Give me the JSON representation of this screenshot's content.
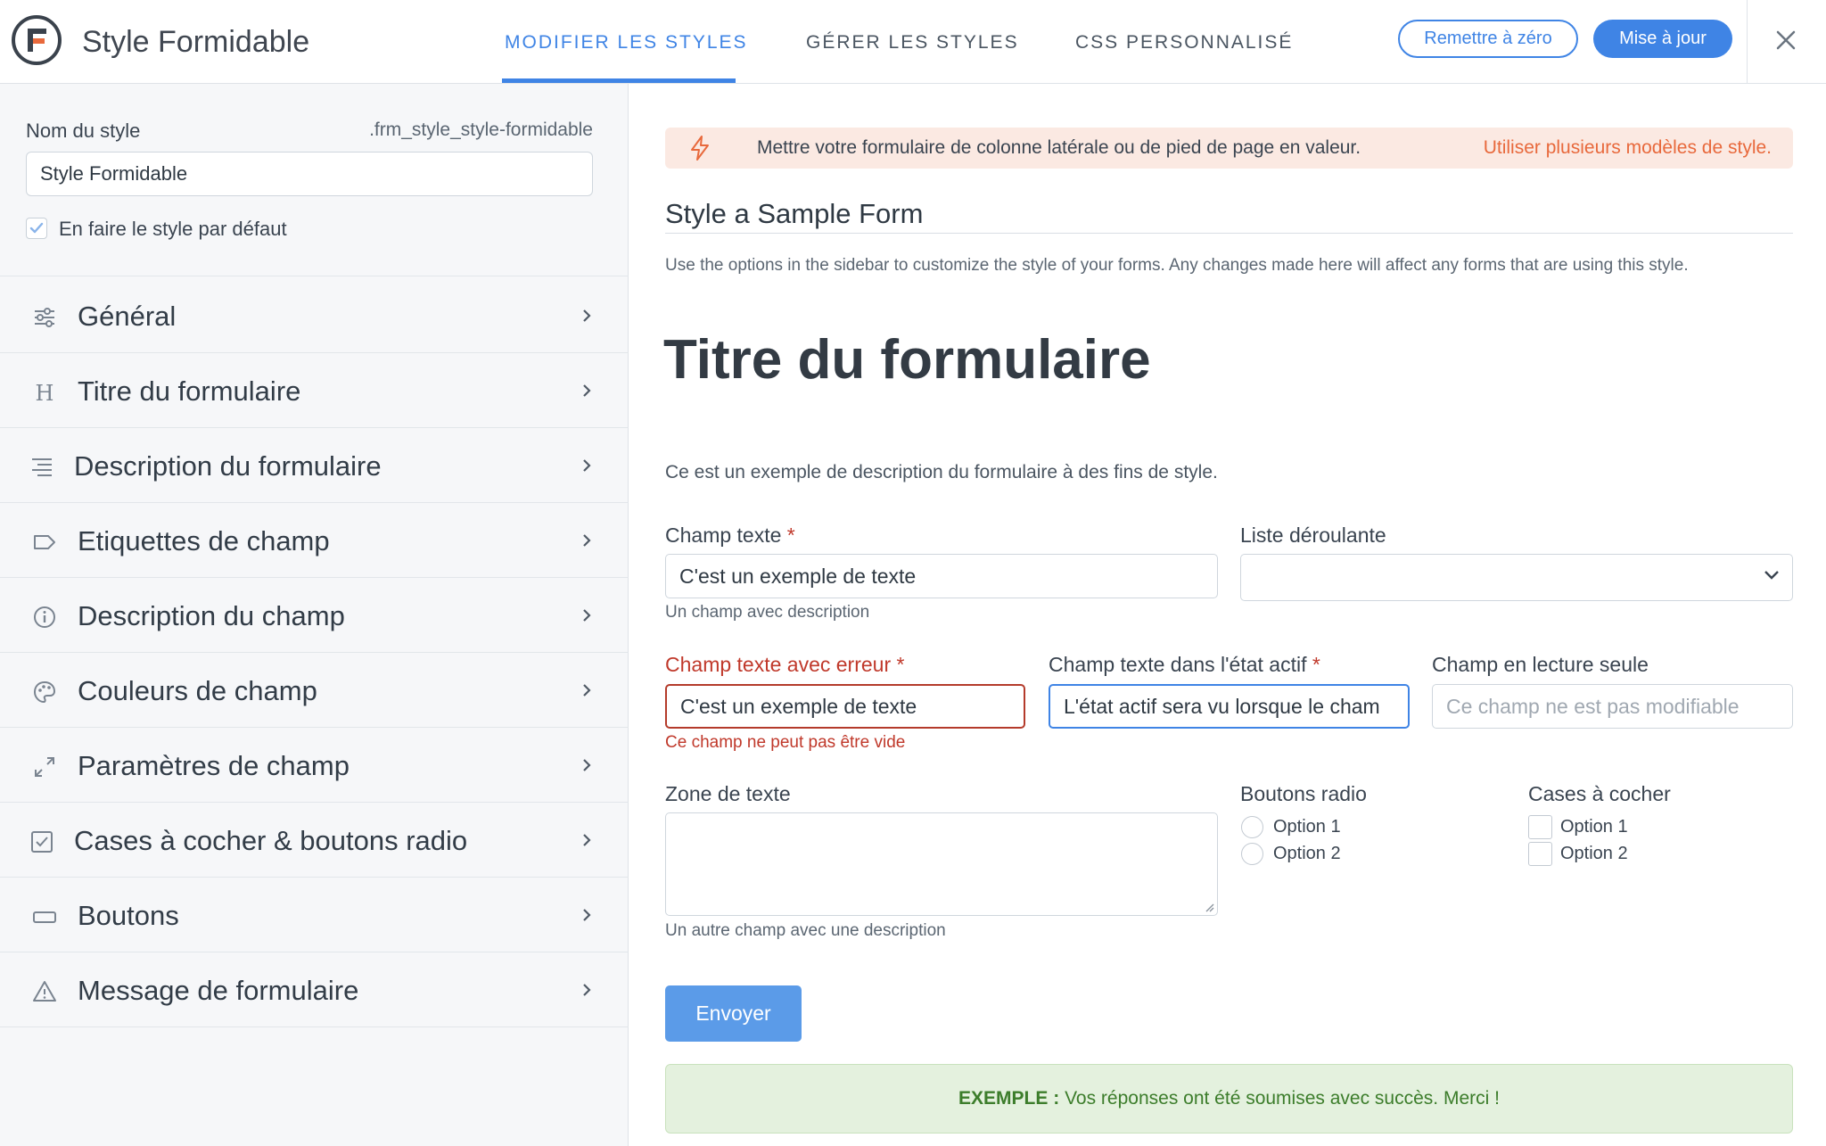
{
  "header": {
    "app_title": "Style Formidable",
    "tabs": [
      {
        "label": "MODIFIER LES STYLES"
      },
      {
        "label": "GÉRER LES STYLES"
      },
      {
        "label": "CSS PERSONNALISÉ"
      }
    ],
    "reset_label": "Remettre à zéro",
    "update_label": "Mise à jour"
  },
  "sidebar": {
    "style_name_label": "Nom du style",
    "style_class": ".frm_style_style-formidable",
    "style_name_value": "Style Formidable",
    "default_checkbox_label": "En faire le style par défaut",
    "default_checked": true,
    "sections": [
      {
        "label": "Général",
        "icon": "sliders-icon"
      },
      {
        "label": "Titre du formulaire",
        "icon": "heading-icon"
      },
      {
        "label": "Description du formulaire",
        "icon": "align-text-icon"
      },
      {
        "label": "Etiquettes de champ",
        "icon": "tag-icon"
      },
      {
        "label": "Description du champ",
        "icon": "info-icon"
      },
      {
        "label": "Couleurs de champ",
        "icon": "palette-icon"
      },
      {
        "label": "Paramètres de champ",
        "icon": "expand-arrows-icon"
      },
      {
        "label": "Cases à cocher & boutons radio",
        "icon": "checkbox-icon"
      },
      {
        "label": "Boutons",
        "icon": "button-icon"
      },
      {
        "label": "Message de formulaire",
        "icon": "warning-icon"
      }
    ]
  },
  "notice": {
    "text": "Mettre votre formulaire de colonne latérale ou de pied de page en valeur.",
    "link": "Utiliser plusieurs modèles de style."
  },
  "preview": {
    "section_title": "Style a Sample Form",
    "section_desc": "Use the options in the sidebar to customize the style of your forms. Any changes made here will affect any forms that are using this style.",
    "form_title": "Titre du formulaire",
    "form_description": "Ce est un exemple de description du formulaire à des fins de style.",
    "fields": {
      "text": {
        "label": "Champ texte",
        "value": "C'est un exemple de texte",
        "help": "Un champ avec description"
      },
      "dropdown": {
        "label": "Liste déroulante",
        "value": ""
      },
      "error": {
        "label": "Champ texte avec erreur",
        "value": "C'est un exemple de texte",
        "help": "Ce champ ne peut pas être vide"
      },
      "active": {
        "label": "Champ texte dans l'état actif",
        "value": "L'état actif sera vu lorsque le cham"
      },
      "readonly": {
        "label": "Champ en lecture seule",
        "placeholder": "Ce champ ne est pas modifiable"
      },
      "textarea": {
        "label": "Zone de texte",
        "help": "Un autre champ avec une description"
      },
      "radios": {
        "label": "Boutons radio",
        "options": [
          "Option 1",
          "Option 2"
        ]
      },
      "checkboxes": {
        "label": "Cases à cocher",
        "options": [
          "Option 1",
          "Option 2"
        ]
      }
    },
    "required_mark": "*",
    "submit_label": "Envoyer",
    "success": {
      "prefix": "EXEMPLE :",
      "message": "Vos réponses ont été soumises avec succès. Merci !"
    }
  },
  "colors": {
    "accent": "#3f84e5",
    "error": "#c0392b",
    "notice_bg": "#fbe9e2",
    "notice_link": "#e8693c",
    "success_bg": "#e4f1de",
    "success_text": "#3c7d2b"
  }
}
